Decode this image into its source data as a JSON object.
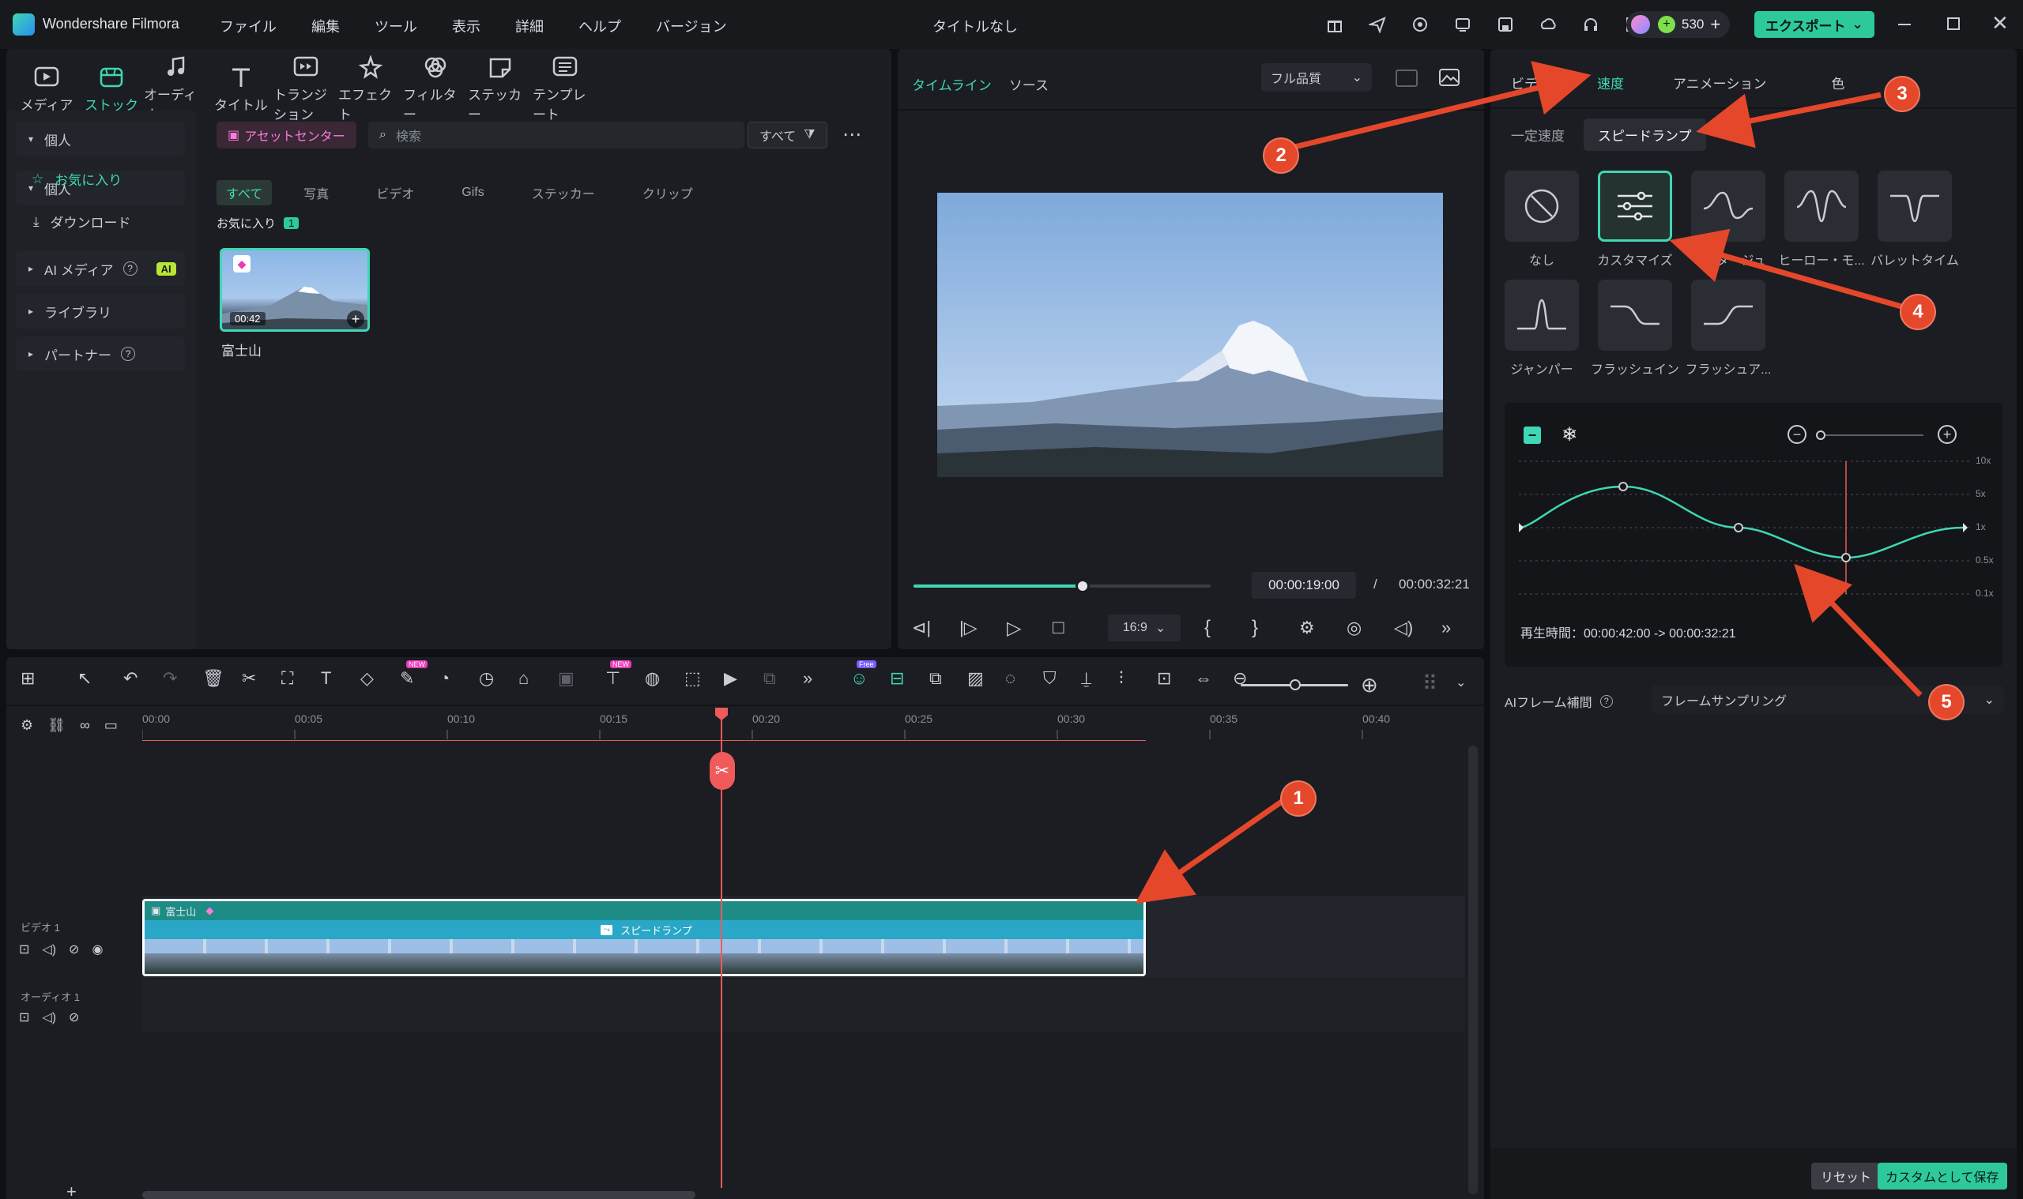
{
  "app": {
    "name": "Wondershare Filmora",
    "doc_title": "タイトルなし",
    "credits": "530",
    "export_label": "エクスポート"
  },
  "menu": [
    "ファイル",
    "編集",
    "ツール",
    "表示",
    "詳細",
    "ヘルプ",
    "バージョン"
  ],
  "toolbar": [
    "メディア",
    "ストック",
    "オーディオ",
    "タイトル",
    "トランジション",
    "エフェクト",
    "フィルター",
    "ステッカー",
    "テンプレート"
  ],
  "sidebar": {
    "personal": "個人",
    "favorites": "お気に入り",
    "download": "ダウンロード",
    "ai_media": "AI メディア",
    "ai_badge": "AI",
    "library": "ライブラリ",
    "partner": "パートナー"
  },
  "library": {
    "asset_center": "アセットセンター",
    "search_placeholder": "検索",
    "filter_all": "すべて",
    "chips": [
      "すべて",
      "写真",
      "ビデオ",
      "Gifs",
      "ステッカー",
      "クリップ"
    ],
    "section": "お気に入り",
    "section_count": "1",
    "item": {
      "duration": "00:42",
      "name": "富士山"
    }
  },
  "preview": {
    "tab_timeline": "タイムライン",
    "tab_source": "ソース",
    "quality": "フル品質",
    "current_time": "00:00:19:00",
    "separator": "/",
    "total_time": "00:00:32:21",
    "aspect": "16:9",
    "progress": 0.57
  },
  "inspector": {
    "tabs": [
      "ビデオ",
      "速度",
      "アニメーション",
      "色"
    ],
    "subtabs": [
      "一定速度",
      "スピードランプ"
    ],
    "presets": [
      "なし",
      "カスタマイズ",
      "モンタージュ",
      "ヒーロー・モ...",
      "バレットタイム",
      "ジャンパー",
      "フラッシュイン",
      "フラッシュア..."
    ],
    "curve_labels": [
      "10x",
      "5x",
      "1x",
      "0.5x",
      "0.1x"
    ],
    "playback": "再生時間：00:00:42:00 -> 00:00:32:21",
    "ai_frame_label": "AIフレーム補間",
    "ai_frame_value": "フレームサンプリング",
    "reset": "リセット",
    "save_custom": "カスタムとして保存"
  },
  "timeline": {
    "ruler": [
      "00:00",
      "00:05",
      "00:10",
      "00:15",
      "00:20",
      "00:25",
      "00:30",
      "00:35",
      "00:40"
    ],
    "video_track": "ビデオ 1",
    "audio_track": "オーディオ 1",
    "clip_name": "富士山",
    "clip_effect": "スピードランプ",
    "badge_new": "NEW",
    "badge_free": "Free"
  },
  "callouts": [
    "1",
    "2",
    "3",
    "4",
    "5"
  ],
  "colors": {
    "accent": "#3fd7b5",
    "playhead": "#f05a5a",
    "callout": "#e5472a",
    "clip": "#1e8c86"
  }
}
